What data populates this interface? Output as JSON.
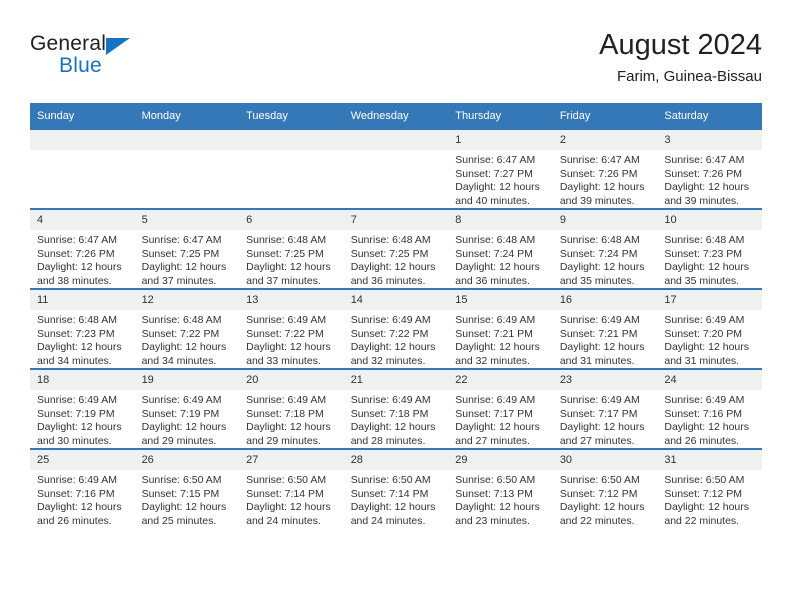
{
  "brand": {
    "line1": "General",
    "line2": "Blue",
    "triangle_icon": "triangle-icon",
    "accent_color": "#1673c4"
  },
  "header": {
    "title": "August 2024",
    "subtitle": "Farim, Guinea-Bissau"
  },
  "theme": {
    "header_blue": "#3478b8",
    "date_band_gray": "#f0f0f0",
    "text": "#333333"
  },
  "calendar": {
    "weekday_headers": [
      "Sunday",
      "Monday",
      "Tuesday",
      "Wednesday",
      "Thursday",
      "Friday",
      "Saturday"
    ],
    "labels": {
      "sunrise": "Sunrise:",
      "sunset": "Sunset:",
      "daylight": "Daylight:"
    },
    "weeks": [
      [
        {
          "day": "",
          "sunrise": "",
          "sunset": "",
          "daylight_a": "",
          "daylight_b": ""
        },
        {
          "day": "",
          "sunrise": "",
          "sunset": "",
          "daylight_a": "",
          "daylight_b": ""
        },
        {
          "day": "",
          "sunrise": "",
          "sunset": "",
          "daylight_a": "",
          "daylight_b": ""
        },
        {
          "day": "",
          "sunrise": "",
          "sunset": "",
          "daylight_a": "",
          "daylight_b": ""
        },
        {
          "day": "1",
          "sunrise": "Sunrise: 6:47 AM",
          "sunset": "Sunset: 7:27 PM",
          "daylight_a": "Daylight: 12 hours",
          "daylight_b": "and 40 minutes."
        },
        {
          "day": "2",
          "sunrise": "Sunrise: 6:47 AM",
          "sunset": "Sunset: 7:26 PM",
          "daylight_a": "Daylight: 12 hours",
          "daylight_b": "and 39 minutes."
        },
        {
          "day": "3",
          "sunrise": "Sunrise: 6:47 AM",
          "sunset": "Sunset: 7:26 PM",
          "daylight_a": "Daylight: 12 hours",
          "daylight_b": "and 39 minutes."
        }
      ],
      [
        {
          "day": "4",
          "sunrise": "Sunrise: 6:47 AM",
          "sunset": "Sunset: 7:26 PM",
          "daylight_a": "Daylight: 12 hours",
          "daylight_b": "and 38 minutes."
        },
        {
          "day": "5",
          "sunrise": "Sunrise: 6:47 AM",
          "sunset": "Sunset: 7:25 PM",
          "daylight_a": "Daylight: 12 hours",
          "daylight_b": "and 37 minutes."
        },
        {
          "day": "6",
          "sunrise": "Sunrise: 6:48 AM",
          "sunset": "Sunset: 7:25 PM",
          "daylight_a": "Daylight: 12 hours",
          "daylight_b": "and 37 minutes."
        },
        {
          "day": "7",
          "sunrise": "Sunrise: 6:48 AM",
          "sunset": "Sunset: 7:25 PM",
          "daylight_a": "Daylight: 12 hours",
          "daylight_b": "and 36 minutes."
        },
        {
          "day": "8",
          "sunrise": "Sunrise: 6:48 AM",
          "sunset": "Sunset: 7:24 PM",
          "daylight_a": "Daylight: 12 hours",
          "daylight_b": "and 36 minutes."
        },
        {
          "day": "9",
          "sunrise": "Sunrise: 6:48 AM",
          "sunset": "Sunset: 7:24 PM",
          "daylight_a": "Daylight: 12 hours",
          "daylight_b": "and 35 minutes."
        },
        {
          "day": "10",
          "sunrise": "Sunrise: 6:48 AM",
          "sunset": "Sunset: 7:23 PM",
          "daylight_a": "Daylight: 12 hours",
          "daylight_b": "and 35 minutes."
        }
      ],
      [
        {
          "day": "11",
          "sunrise": "Sunrise: 6:48 AM",
          "sunset": "Sunset: 7:23 PM",
          "daylight_a": "Daylight: 12 hours",
          "daylight_b": "and 34 minutes."
        },
        {
          "day": "12",
          "sunrise": "Sunrise: 6:48 AM",
          "sunset": "Sunset: 7:22 PM",
          "daylight_a": "Daylight: 12 hours",
          "daylight_b": "and 34 minutes."
        },
        {
          "day": "13",
          "sunrise": "Sunrise: 6:49 AM",
          "sunset": "Sunset: 7:22 PM",
          "daylight_a": "Daylight: 12 hours",
          "daylight_b": "and 33 minutes."
        },
        {
          "day": "14",
          "sunrise": "Sunrise: 6:49 AM",
          "sunset": "Sunset: 7:22 PM",
          "daylight_a": "Daylight: 12 hours",
          "daylight_b": "and 32 minutes."
        },
        {
          "day": "15",
          "sunrise": "Sunrise: 6:49 AM",
          "sunset": "Sunset: 7:21 PM",
          "daylight_a": "Daylight: 12 hours",
          "daylight_b": "and 32 minutes."
        },
        {
          "day": "16",
          "sunrise": "Sunrise: 6:49 AM",
          "sunset": "Sunset: 7:21 PM",
          "daylight_a": "Daylight: 12 hours",
          "daylight_b": "and 31 minutes."
        },
        {
          "day": "17",
          "sunrise": "Sunrise: 6:49 AM",
          "sunset": "Sunset: 7:20 PM",
          "daylight_a": "Daylight: 12 hours",
          "daylight_b": "and 31 minutes."
        }
      ],
      [
        {
          "day": "18",
          "sunrise": "Sunrise: 6:49 AM",
          "sunset": "Sunset: 7:19 PM",
          "daylight_a": "Daylight: 12 hours",
          "daylight_b": "and 30 minutes."
        },
        {
          "day": "19",
          "sunrise": "Sunrise: 6:49 AM",
          "sunset": "Sunset: 7:19 PM",
          "daylight_a": "Daylight: 12 hours",
          "daylight_b": "and 29 minutes."
        },
        {
          "day": "20",
          "sunrise": "Sunrise: 6:49 AM",
          "sunset": "Sunset: 7:18 PM",
          "daylight_a": "Daylight: 12 hours",
          "daylight_b": "and 29 minutes."
        },
        {
          "day": "21",
          "sunrise": "Sunrise: 6:49 AM",
          "sunset": "Sunset: 7:18 PM",
          "daylight_a": "Daylight: 12 hours",
          "daylight_b": "and 28 minutes."
        },
        {
          "day": "22",
          "sunrise": "Sunrise: 6:49 AM",
          "sunset": "Sunset: 7:17 PM",
          "daylight_a": "Daylight: 12 hours",
          "daylight_b": "and 27 minutes."
        },
        {
          "day": "23",
          "sunrise": "Sunrise: 6:49 AM",
          "sunset": "Sunset: 7:17 PM",
          "daylight_a": "Daylight: 12 hours",
          "daylight_b": "and 27 minutes."
        },
        {
          "day": "24",
          "sunrise": "Sunrise: 6:49 AM",
          "sunset": "Sunset: 7:16 PM",
          "daylight_a": "Daylight: 12 hours",
          "daylight_b": "and 26 minutes."
        }
      ],
      [
        {
          "day": "25",
          "sunrise": "Sunrise: 6:49 AM",
          "sunset": "Sunset: 7:16 PM",
          "daylight_a": "Daylight: 12 hours",
          "daylight_b": "and 26 minutes."
        },
        {
          "day": "26",
          "sunrise": "Sunrise: 6:50 AM",
          "sunset": "Sunset: 7:15 PM",
          "daylight_a": "Daylight: 12 hours",
          "daylight_b": "and 25 minutes."
        },
        {
          "day": "27",
          "sunrise": "Sunrise: 6:50 AM",
          "sunset": "Sunset: 7:14 PM",
          "daylight_a": "Daylight: 12 hours",
          "daylight_b": "and 24 minutes."
        },
        {
          "day": "28",
          "sunrise": "Sunrise: 6:50 AM",
          "sunset": "Sunset: 7:14 PM",
          "daylight_a": "Daylight: 12 hours",
          "daylight_b": "and 24 minutes."
        },
        {
          "day": "29",
          "sunrise": "Sunrise: 6:50 AM",
          "sunset": "Sunset: 7:13 PM",
          "daylight_a": "Daylight: 12 hours",
          "daylight_b": "and 23 minutes."
        },
        {
          "day": "30",
          "sunrise": "Sunrise: 6:50 AM",
          "sunset": "Sunset: 7:12 PM",
          "daylight_a": "Daylight: 12 hours",
          "daylight_b": "and 22 minutes."
        },
        {
          "day": "31",
          "sunrise": "Sunrise: 6:50 AM",
          "sunset": "Sunset: 7:12 PM",
          "daylight_a": "Daylight: 12 hours",
          "daylight_b": "and 22 minutes."
        }
      ]
    ]
  }
}
